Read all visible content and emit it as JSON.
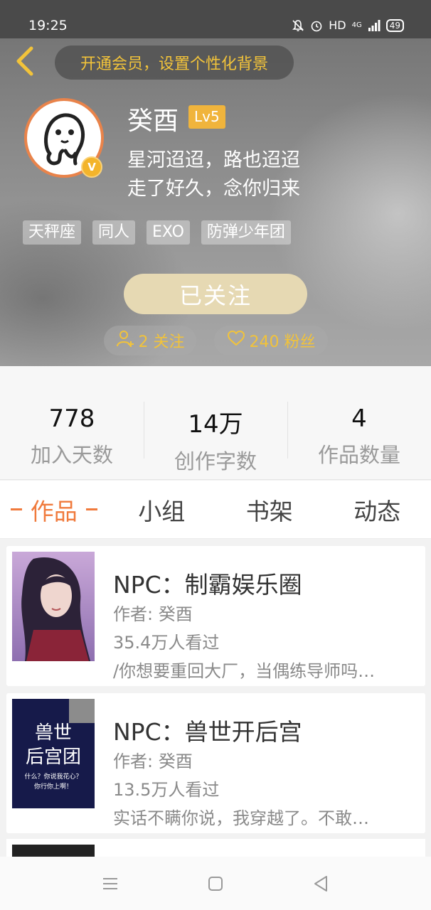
{
  "status_bar": {
    "time": "19:25",
    "network": "HD",
    "signal": "4G",
    "battery": "49"
  },
  "header": {
    "vip_prompt": "开通会员，设置个性化背景"
  },
  "profile": {
    "name": "癸酉",
    "level": "Lv5",
    "bio_line1": "星河迢迢，路也迢迢",
    "bio_line2": "走了好久，念你归来",
    "tags": [
      "天秤座",
      "同人",
      "EXO",
      "防弹少年团"
    ],
    "follow_button": "已关注",
    "following": "2 关注",
    "fans": "240 粉丝"
  },
  "stats": [
    {
      "value": "778",
      "label": "加入天数"
    },
    {
      "value": "14万",
      "label": "创作字数"
    },
    {
      "value": "4",
      "label": "作品数量"
    }
  ],
  "tabs": [
    "作品",
    "小组",
    "书架",
    "动态"
  ],
  "works": [
    {
      "title": "NPC：制霸娱乐圈",
      "author": "作者: 癸酉",
      "views": "35.4万人看过",
      "description": "/你想要重回大厂，当偶练导师吗…"
    },
    {
      "title": "NPC：兽世开后宫",
      "author": "作者: 癸酉",
      "views": "13.5万人看过",
      "description": "实话不瞒你说，我穿越了。不敢…",
      "cover_text_line1": "兽世",
      "cover_text_line2": "后宫团",
      "cover_text_line3": "什么？你说我花心？",
      "cover_text_line4": "你行你上啊！"
    }
  ],
  "colors": {
    "accent": "#f07a3c",
    "gold": "#f2c33a",
    "level_badge": "#f0b43c",
    "follow_button": "#e6d9b3"
  },
  "icons": [
    "bell-muted-icon",
    "alarm-icon",
    "back-chevron-icon",
    "verified-v-icon",
    "person-add-icon",
    "heart-icon",
    "menu-icon",
    "home-square-icon",
    "back-triangle-icon"
  ]
}
